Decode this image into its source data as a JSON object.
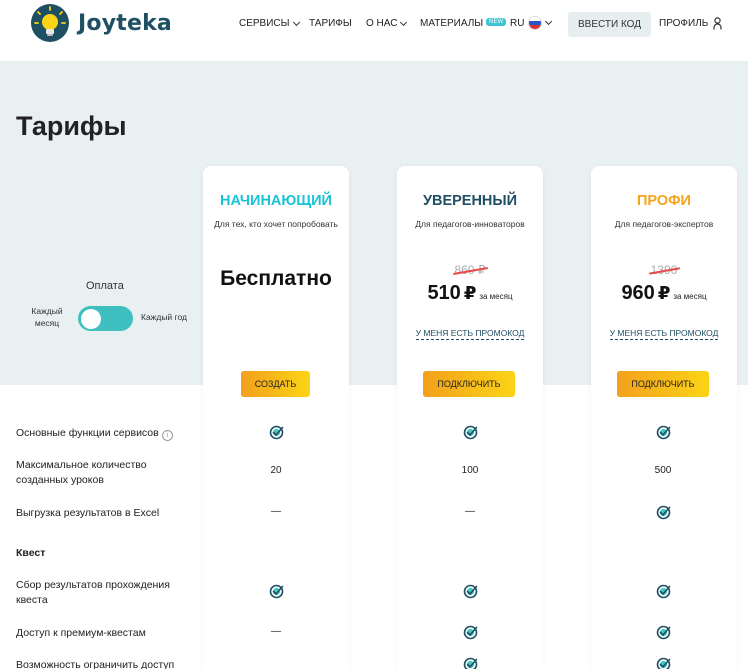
{
  "header": {
    "brand": "Joyteka",
    "nav": [
      {
        "label": "СЕРВИСЫ"
      },
      {
        "label": "ТАРИФЫ"
      },
      {
        "label": "О НАС"
      },
      {
        "label": "МАТЕРИАЛЫ",
        "badge": "NEW"
      },
      {
        "label": "RU"
      }
    ],
    "code_button": "ВВЕСТИ КОД",
    "profile": "ПРОФИЛЬ"
  },
  "page": {
    "title": "Тарифы",
    "payment": {
      "label": "Оплата",
      "monthly": "Каждый месяц",
      "yearly": "Каждый год"
    }
  },
  "plans": [
    {
      "name": "НАЧИНАЮЩИЙ",
      "color": "#19c3d6",
      "subtitle": "Для тех, кто хочет попробовать",
      "free_label": "Бесплатно",
      "button": "СОЗДАТЬ"
    },
    {
      "name": "УВЕРЕННЫЙ",
      "color": "#1f4f63",
      "subtitle": "Для педагогов-инноваторов",
      "old_price": "860 ₽",
      "price": "510",
      "currency": "₽",
      "per": "за месяц",
      "promo": "У МЕНЯ ЕСТЬ ПРОМОКОД",
      "button": "ПОДКЛЮЧИТЬ"
    },
    {
      "name": "ПРОФИ",
      "color": "#f5a31a",
      "subtitle": "Для педагогов-экспертов",
      "old_price": "1390",
      "price": "960",
      "currency": "₽",
      "per": "за месяц",
      "promo": "У МЕНЯ ЕСТЬ ПРОМОКОД",
      "button": "ПОДКЛЮЧИТЬ"
    }
  ],
  "features": [
    {
      "label": "Основные функции сервисов",
      "info": "i",
      "values": [
        "check",
        "check",
        "check"
      ]
    },
    {
      "label": "Максимальное количество созданных уроков",
      "values": [
        "20",
        "100",
        "500"
      ]
    },
    {
      "label": "Выгрузка результатов в Excel",
      "values": [
        "—",
        "—",
        "check"
      ]
    },
    {
      "label": "Квест",
      "section": true
    },
    {
      "label": "Сбор результатов прохождения квеста",
      "values": [
        "check",
        "check",
        "check"
      ]
    },
    {
      "label": "Доступ к премиум-квестам",
      "values": [
        "—",
        "check",
        "check"
      ]
    },
    {
      "label": "Возможность ограничить доступ",
      "values": [
        "",
        "check",
        "check"
      ]
    }
  ],
  "colors": {
    "accent_teal": "#3fbfbf",
    "hero_bg": "#e9f0f2",
    "brand_dark": "#1f4f63"
  }
}
